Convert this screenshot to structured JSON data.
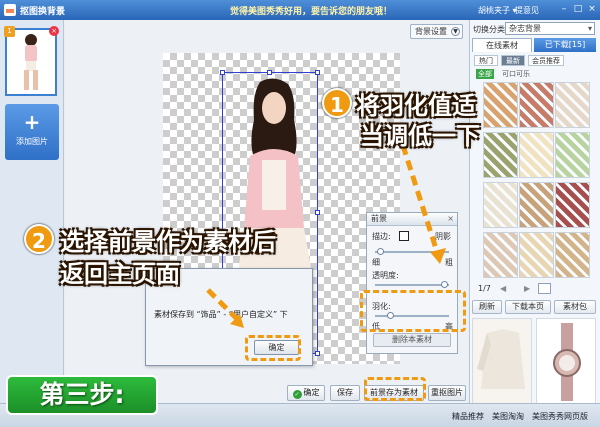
{
  "window": {
    "title": "抠图换背景",
    "slogan": "觉得美图秀秀好用，要告诉您的朋友哦！",
    "user": "胡桃夹子 ▾",
    "feedback": "提意见",
    "controls": [
      "–",
      "□",
      "×"
    ]
  },
  "left": {
    "thumb_badge": "1",
    "add_label": "添加图片",
    "add_plus": "+"
  },
  "canvas": {
    "bg_setting": "背景设置"
  },
  "fg_panel": {
    "title": "前景",
    "edge_label": "描边:",
    "shadow_label": "阴影",
    "thin": "细",
    "thick": "粗",
    "opacity_label": "透明度:",
    "feather_label": "羽化:",
    "low": "低",
    "high": "高",
    "delete_label": "删除本素材"
  },
  "save_dialog": {
    "message": "素材保存到 “饰品” - “用户自定义” 下",
    "ok_label": "确定"
  },
  "toolbar": {
    "confirm": "确定",
    "save": "保存",
    "save_fg": "前景存为素材",
    "redo": "重抠图片"
  },
  "right": {
    "category_label": "切换分类",
    "category_value": "杂志背景",
    "tab_online": "在线素材",
    "tab_downloaded": "已下载[15]",
    "sub_hot": "热门",
    "sub_new": "最新",
    "sub_member": "会员推荐",
    "filter_all": "全部",
    "filter_free": "可口可乐",
    "pager": "1/7",
    "refresh": "刷新",
    "download_page": "下载本页",
    "material_pack": "素材包",
    "grid_colors": [
      "#d9a36f",
      "#c77c6a",
      "#e6d8c8",
      "#9aa36d",
      "#f1e2c0",
      "#b9d3a0",
      "#e9e2d0",
      "#c8a27a",
      "#a74f4f",
      "#dcc8b4",
      "#e8d6b3",
      "#d3b48a"
    ]
  },
  "status": {
    "recommend": "精品推荐",
    "meitu_ad": "美图淘淘",
    "mobile": "美图秀秀网页版"
  },
  "overlays": {
    "num1": "1",
    "text1_line1": "将羽化值适",
    "text1_line2": "当调低一下",
    "num2": "2",
    "text2_line1": "选择前景作为素材后",
    "text2_line2": "返回主页面",
    "step": "第三步:"
  },
  "colors": {
    "accent": "#f09a12",
    "title_bar": "#2a66b8",
    "step_green": "#1c8f28"
  }
}
